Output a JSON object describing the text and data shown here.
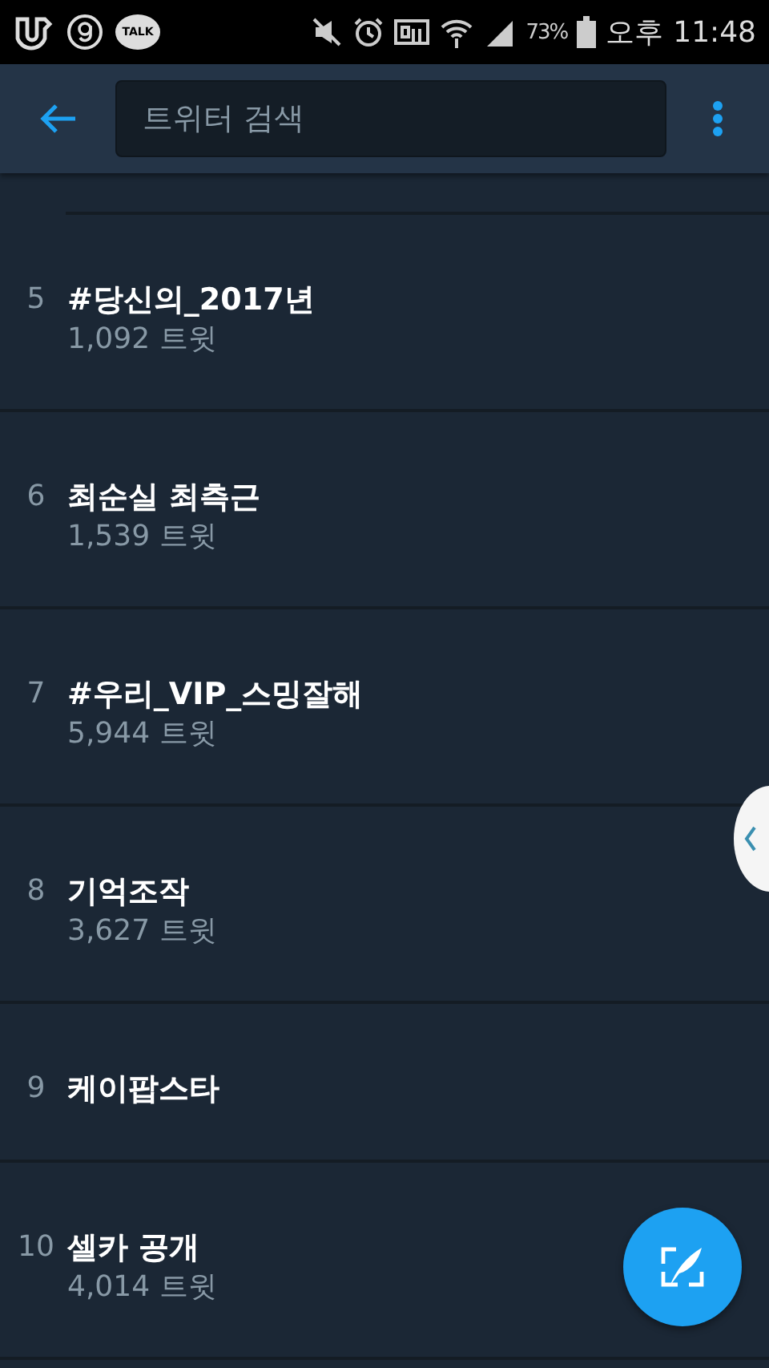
{
  "status_bar": {
    "talk_icon_label": "TALK",
    "battery": "73%",
    "ampm": "오후",
    "time": "11:48"
  },
  "toolbar": {
    "search": {
      "placeholder": "트위터 검색"
    }
  },
  "trends": [
    {
      "rank": "5",
      "title": "#당신의_2017년",
      "count": "1,092 트윗"
    },
    {
      "rank": "6",
      "title": "최순실 최측근",
      "count": "1,539 트윗"
    },
    {
      "rank": "7",
      "title": "#우리_VIP_스밍잘해",
      "count": "5,944 트윗"
    },
    {
      "rank": "8",
      "title": "기억조작",
      "count": "3,627 트윗"
    },
    {
      "rank": "9",
      "title": "케이팝스타"
    },
    {
      "rank": "10",
      "title": "셀카 공개",
      "count": "4,014 트윗"
    }
  ]
}
